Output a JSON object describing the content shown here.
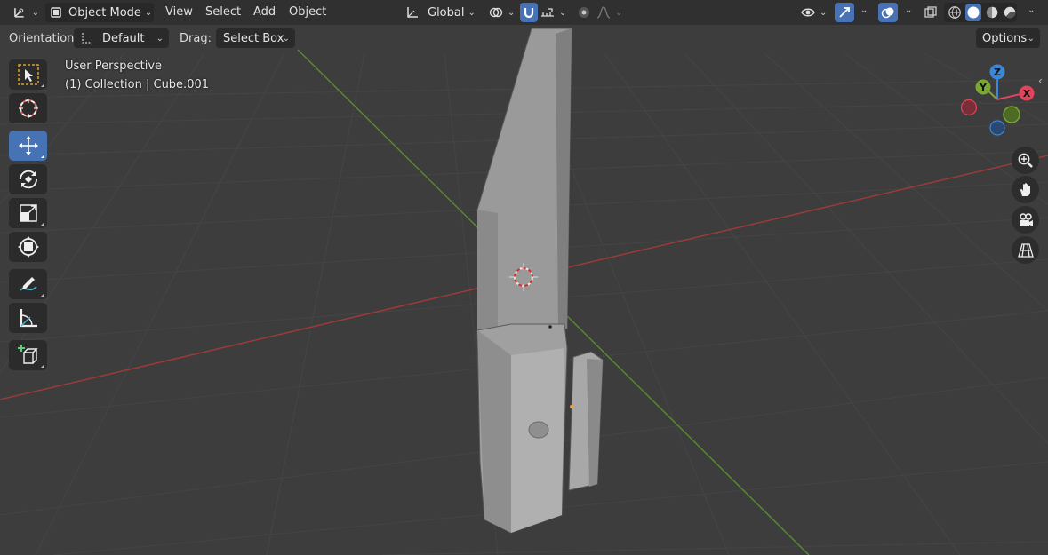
{
  "header": {
    "mode_label": "Object Mode",
    "menus": [
      "View",
      "Select",
      "Add",
      "Object"
    ],
    "orientation_label": "Global"
  },
  "tool_settings": {
    "orientation_label": "Orientation:",
    "orientation_value": "Default",
    "drag_label": "Drag:",
    "drag_value": "Select Box",
    "options_label": "Options"
  },
  "viewport": {
    "view_name": "User Perspective",
    "collection_info": "(1) Collection | Cube.001"
  },
  "gizmo": {
    "axis_x": "X",
    "axis_y": "Y",
    "axis_z": "Z",
    "colors": {
      "x": "#e0455a",
      "y": "#7aa832",
      "z": "#3b87d8"
    }
  },
  "toolbar": {
    "tools": [
      "select-box",
      "cursor",
      "move",
      "rotate",
      "scale",
      "transform",
      "annotate",
      "measure",
      "add-cube"
    ],
    "active_tool": "move"
  },
  "navigation": [
    "zoom-icon",
    "pan-hand-icon",
    "camera-icon",
    "grid-perspective-icon"
  ],
  "colors": {
    "accent": "#4772b3",
    "background": "#3d3d3d",
    "x_axis_line": "#a03a3a",
    "y_axis_line": "#5b8a2e"
  }
}
